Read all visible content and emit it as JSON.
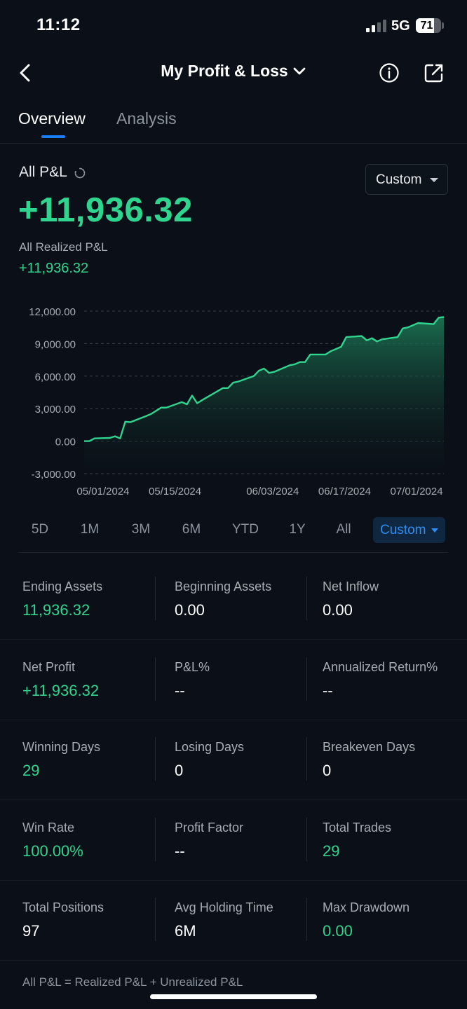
{
  "status_bar": {
    "time": "11:12",
    "network": "5G",
    "battery": "71"
  },
  "nav": {
    "title": "My Profit & Loss"
  },
  "tabs": [
    {
      "label": "Overview",
      "active": true
    },
    {
      "label": "Analysis",
      "active": false
    }
  ],
  "summary": {
    "all_pnl_label": "All P&L",
    "all_pnl_value": "+11,936.32",
    "period_selector": "Custom",
    "realized_label": "All Realized P&L",
    "realized_value": "+11,936.32"
  },
  "chart_data": {
    "type": "area",
    "y_ticks": [
      "12,000.00",
      "9,000.00",
      "6,000.00",
      "3,000.00",
      "0.00",
      "-3,000.00"
    ],
    "x_ticks": [
      "05/01/2024",
      "05/15/2024",
      "06/03/2024",
      "06/17/2024",
      "07/01/2024"
    ],
    "ylim": [
      -3000,
      12000
    ],
    "grid": true,
    "line_color": "#2fd48f",
    "x": [
      "05/01/2024",
      "05/02/2024",
      "05/03/2024",
      "05/06/2024",
      "05/07/2024",
      "05/08/2024",
      "05/09/2024",
      "05/10/2024",
      "05/13/2024",
      "05/14/2024",
      "05/15/2024",
      "05/16/2024",
      "05/17/2024",
      "05/20/2024",
      "05/21/2024",
      "05/22/2024",
      "05/23/2024",
      "05/24/2024",
      "05/28/2024",
      "05/29/2024",
      "05/30/2024",
      "05/31/2024",
      "06/03/2024",
      "06/04/2024",
      "06/05/2024",
      "06/06/2024",
      "06/07/2024",
      "06/10/2024",
      "06/11/2024",
      "06/12/2024",
      "06/13/2024",
      "06/14/2024",
      "06/17/2024",
      "06/18/2024",
      "06/20/2024",
      "06/21/2024",
      "06/24/2024",
      "06/25/2024",
      "06/26/2024",
      "06/27/2024",
      "06/28/2024",
      "07/01/2024",
      "07/02/2024",
      "07/03/2024",
      "07/05/2024",
      "07/08/2024",
      "07/09/2024",
      "07/10/2024"
    ],
    "values": [
      0,
      0,
      250,
      300,
      450,
      250,
      1800,
      1750,
      2300,
      2500,
      2800,
      3100,
      3100,
      3600,
      3400,
      4200,
      3500,
      3800,
      4900,
      4900,
      5400,
      5500,
      6000,
      6500,
      6700,
      6300,
      6400,
      7000,
      7100,
      7300,
      7300,
      8000,
      8000,
      8300,
      8700,
      9600,
      9700,
      9300,
      9500,
      9200,
      9400,
      9600,
      10400,
      10500,
      10900,
      10800,
      11400,
      11450
    ]
  },
  "ranges": [
    "5D",
    "1M",
    "3M",
    "6M",
    "YTD",
    "1Y",
    "All"
  ],
  "custom_range": "Custom",
  "stats": [
    [
      {
        "label": "Ending Assets",
        "value": "11,936.32",
        "green": true
      },
      {
        "label": "Beginning Assets",
        "value": "0.00",
        "green": false
      },
      {
        "label": "Net Inflow",
        "value": "0.00",
        "green": false
      }
    ],
    [
      {
        "label": "Net Profit",
        "value": "+11,936.32",
        "green": true
      },
      {
        "label": "P&L%",
        "value": "--",
        "green": false
      },
      {
        "label": "Annualized Return%",
        "value": "--",
        "green": false
      }
    ],
    [
      {
        "label": "Winning Days",
        "value": "29",
        "green": true
      },
      {
        "label": "Losing Days",
        "value": "0",
        "green": false
      },
      {
        "label": "Breakeven Days",
        "value": "0",
        "green": false
      }
    ],
    [
      {
        "label": "Win Rate",
        "value": "100.00%",
        "green": true
      },
      {
        "label": "Profit Factor",
        "value": "--",
        "green": false
      },
      {
        "label": "Total Trades",
        "value": "29",
        "green": true
      }
    ],
    [
      {
        "label": "Total Positions",
        "value": "97",
        "green": false
      },
      {
        "label": "Avg Holding Time",
        "value": "6M",
        "green": false
      },
      {
        "label": "Max Drawdown",
        "value": "0.00",
        "green": true
      }
    ]
  ],
  "footnote": "All P&L = Realized P&L + Unrealized P&L"
}
